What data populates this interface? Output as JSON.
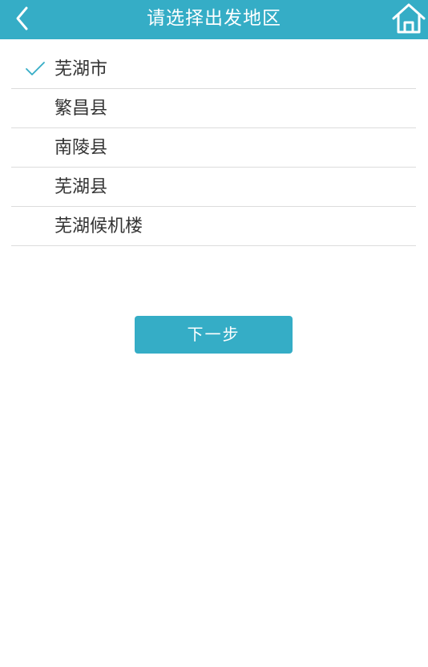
{
  "header": {
    "title": "请选择出发地区",
    "back_icon": "chevron-left-icon",
    "home_icon": "home-icon"
  },
  "list": {
    "selected_index": 0,
    "items": [
      {
        "label": "芜湖市",
        "selected": true
      },
      {
        "label": "繁昌县",
        "selected": false
      },
      {
        "label": "南陵县",
        "selected": false
      },
      {
        "label": "芜湖县",
        "selected": false
      },
      {
        "label": "芜湖候机楼",
        "selected": false
      }
    ]
  },
  "actions": {
    "next_label": "下一步"
  },
  "colors": {
    "accent": "#35adc6",
    "divider": "#dcdcdc",
    "text": "#333333"
  }
}
